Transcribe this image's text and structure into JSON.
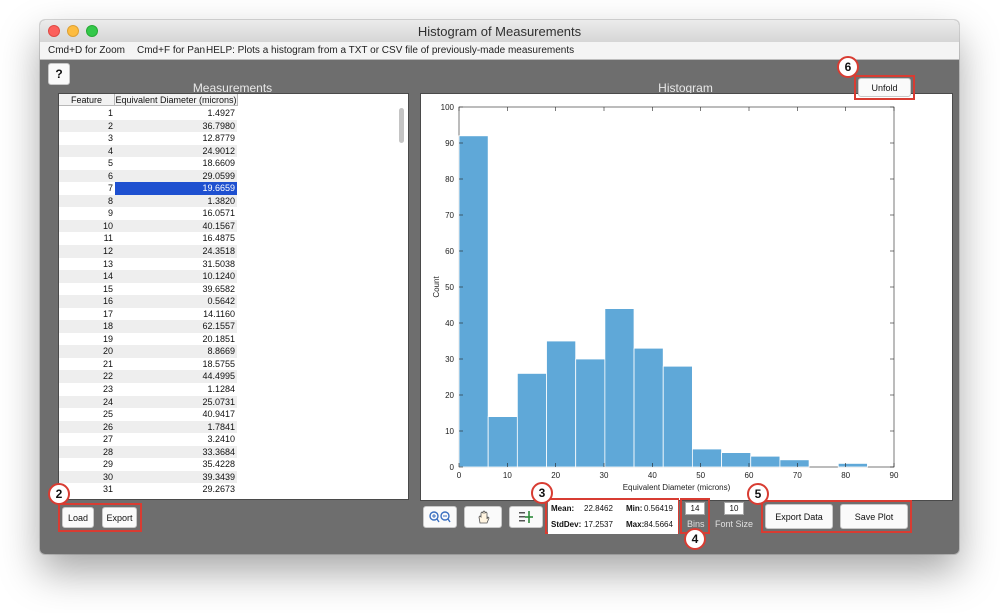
{
  "window": {
    "title": "Histogram of Measurements"
  },
  "menubar": {
    "items": [
      "Cmd+D for Zoom",
      "Cmd+F for Pan",
      "HELP:  Plots a histogram from a TXT or CSV file of previously-made measurements"
    ]
  },
  "buttons": {
    "help": "?",
    "load": "Load",
    "export": "Export",
    "unfold": "Unfold",
    "export_data": "Export Data",
    "save_plot": "Save Plot"
  },
  "measurements": {
    "title": "Measurements",
    "columns": [
      "Feature",
      "Equivalent Diameter (microns)"
    ],
    "selected_feature": "7",
    "rows": [
      [
        "1",
        "1.4927"
      ],
      [
        "2",
        "36.7980"
      ],
      [
        "3",
        "12.8779"
      ],
      [
        "4",
        "24.9012"
      ],
      [
        "5",
        "18.6609"
      ],
      [
        "6",
        "29.0599"
      ],
      [
        "7",
        "19.6659"
      ],
      [
        "8",
        "1.3820"
      ],
      [
        "9",
        "16.0571"
      ],
      [
        "10",
        "40.1567"
      ],
      [
        "11",
        "16.4875"
      ],
      [
        "12",
        "24.3518"
      ],
      [
        "13",
        "31.5038"
      ],
      [
        "14",
        "10.1240"
      ],
      [
        "15",
        "39.6582"
      ],
      [
        "16",
        "0.5642"
      ],
      [
        "17",
        "14.1160"
      ],
      [
        "18",
        "62.1557"
      ],
      [
        "19",
        "20.1851"
      ],
      [
        "20",
        "8.8669"
      ],
      [
        "21",
        "18.5755"
      ],
      [
        "22",
        "44.4995"
      ],
      [
        "23",
        "1.1284"
      ],
      [
        "24",
        "25.0731"
      ],
      [
        "25",
        "40.9417"
      ],
      [
        "26",
        "1.7841"
      ],
      [
        "27",
        "3.2410"
      ],
      [
        "28",
        "33.3684"
      ],
      [
        "29",
        "35.4228"
      ],
      [
        "30",
        "39.3439"
      ],
      [
        "31",
        "29.2673"
      ]
    ]
  },
  "histogram": {
    "title": "Histogram"
  },
  "chart_data": {
    "type": "bar",
    "title": "",
    "xlabel": "Equivalent Diameter (microns)",
    "ylabel": "Count",
    "bin_edges": [
      0,
      6.036,
      12.072,
      18.108,
      24.144,
      30.18,
      36.216,
      42.252,
      48.288,
      54.324,
      60.36,
      66.396,
      72.432,
      78.468,
      84.504
    ],
    "values": [
      92,
      14,
      26,
      35,
      30,
      44,
      33,
      28,
      5,
      4,
      3,
      2,
      0,
      1
    ],
    "xlim": [
      0,
      90
    ],
    "ylim": [
      0,
      100
    ],
    "xticks": [
      0,
      10,
      20,
      30,
      40,
      50,
      60,
      70,
      80,
      90
    ],
    "yticks": [
      0,
      10,
      20,
      30,
      40,
      50,
      60,
      70,
      80,
      90,
      100
    ],
    "bar_color": "#5fa8d8"
  },
  "stats": {
    "mean_label": "Mean:",
    "mean": "22.8462",
    "min_label": "Min:",
    "min": "0.56419",
    "stddev_label": "StdDev:",
    "stddev": "17.2537",
    "max_label": "Max:",
    "max": "84.5664"
  },
  "controls": {
    "bins_value": "14",
    "bins_label": "Bins",
    "font_size_value": "10",
    "font_size_label": "Font Size"
  },
  "toolbar_icons": [
    "zoom-in-out-icon",
    "pan-hand-icon",
    "data-cursor-icon"
  ],
  "callouts": [
    "2",
    "3",
    "4",
    "5",
    "6"
  ],
  "colors": {
    "callout": "#d83c32",
    "selection": "#1e50d0",
    "panel_bg": "#6e6e6e"
  }
}
